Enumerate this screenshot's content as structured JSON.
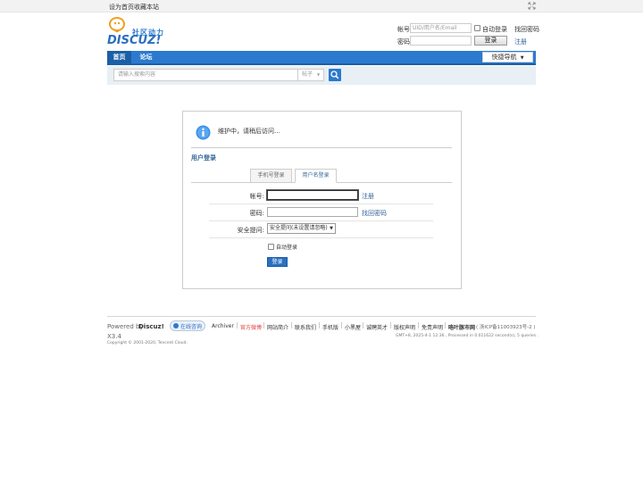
{
  "topbar": {
    "set_home": "设为首页",
    "bookmark": "收藏本站"
  },
  "header": {
    "logo_text": "DISCUZ!",
    "logo_tagline": "社区动力",
    "login": {
      "account_label": "帐号",
      "account_placeholder": "UID/用户名/Email",
      "auto_login_label": "自动登录",
      "find_password": "找回密码",
      "password_label": "密码",
      "login_button": "登录",
      "register": "注册"
    }
  },
  "nav": {
    "items": [
      {
        "label": "首页",
        "active": true
      },
      {
        "label": "论坛",
        "active": false
      }
    ],
    "quick_nav": "快捷导航"
  },
  "search": {
    "placeholder": "请输入搜索内容",
    "type": "帖子"
  },
  "main": {
    "message": "维护中，请稍后访问…",
    "section_title": "用户登录",
    "tabs": [
      {
        "label": "手机号登录",
        "active": false
      },
      {
        "label": "用户名登录",
        "active": true
      }
    ],
    "form": {
      "account_label": "帐号:",
      "register_link": "注册",
      "password_label": "密码:",
      "find_password_link": "找回密码",
      "security_label": "安全提问:",
      "security_value": "安全提问(未设置请忽略)",
      "auto_login_label": "自动登录",
      "submit": "登录"
    }
  },
  "footer": {
    "powered_by": "Powered by",
    "brand": "Discuz!",
    "version": "X3.4",
    "online_service": "在线咨询",
    "links": [
      "Archiver",
      "官方微博",
      "网站简介",
      "联系我们",
      "手机版",
      "小黑屋",
      "诚聘英才",
      "版权声明",
      "免责声明"
    ],
    "site_name": "咯叶豚市网",
    "icp": "( 浙ICP备11003923号-2 )",
    "processed": "GMT+8, 2025-4-1 12:36 , Processed in 0.011622 second(s), 5 queries .",
    "copyright": "Copyright © 2001-2020, Tencent Cloud."
  },
  "colors": {
    "nav_blue": "#2b7acd",
    "link_blue": "#336699",
    "weibo_red": "#e4393c"
  }
}
